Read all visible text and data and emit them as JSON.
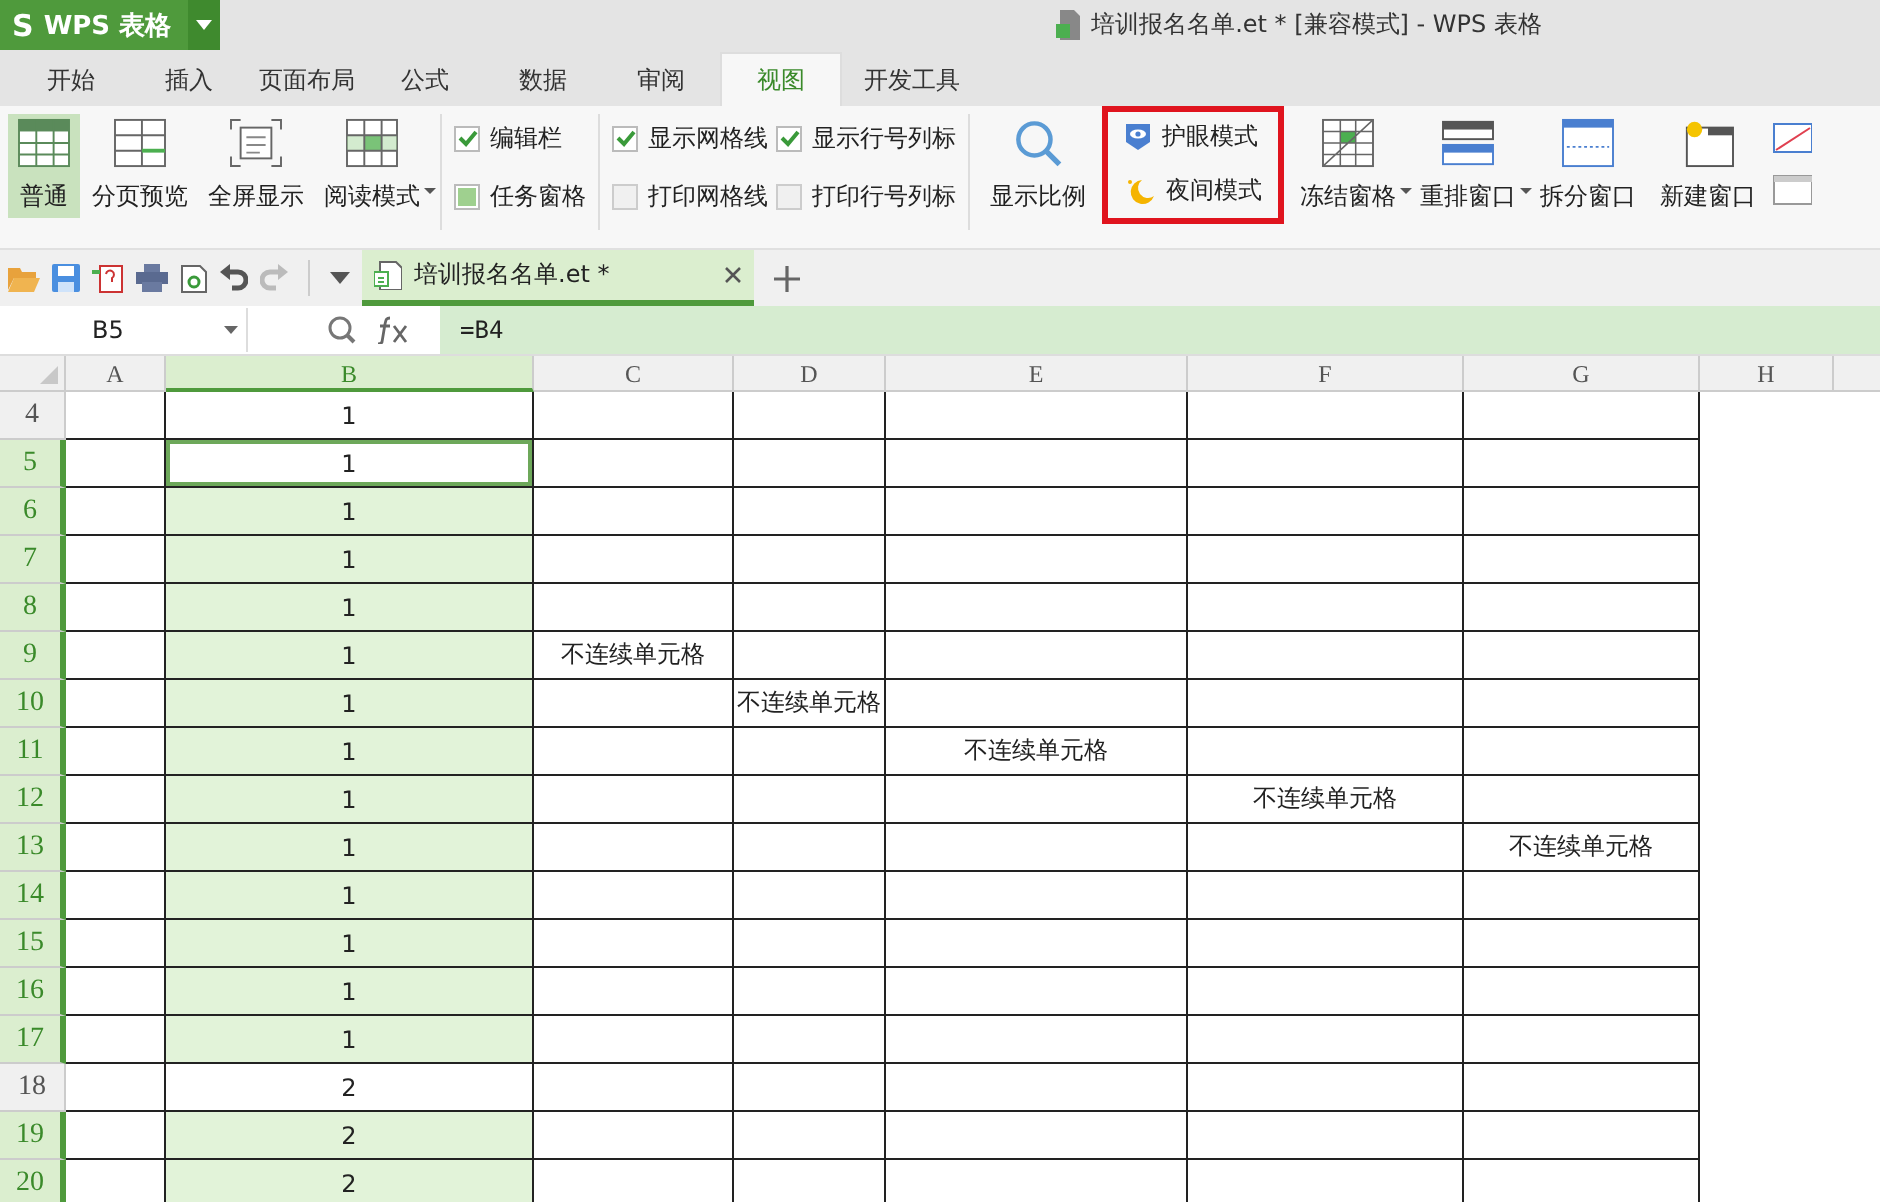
{
  "app": {
    "logo": "S",
    "name": "WPS 表格"
  },
  "window": {
    "title": "培训报名名单.et * [兼容模式] - WPS 表格"
  },
  "tabs": [
    {
      "label": "开始",
      "selected": false
    },
    {
      "label": "插入",
      "selected": false
    },
    {
      "label": "页面布局",
      "selected": false
    },
    {
      "label": "公式",
      "selected": false
    },
    {
      "label": "数据",
      "selected": false
    },
    {
      "label": "审阅",
      "selected": false
    },
    {
      "label": "视图",
      "selected": true
    },
    {
      "label": "开发工具",
      "selected": false
    }
  ],
  "ribbon": {
    "view_buttons": [
      {
        "kind": "normal",
        "label": "普通",
        "selected": true,
        "dropdown": false
      },
      {
        "kind": "page_break",
        "label": "分页预览",
        "selected": false,
        "dropdown": false
      },
      {
        "kind": "fullscreen",
        "label": "全屏显示",
        "selected": false,
        "dropdown": false
      },
      {
        "kind": "reading",
        "label": "阅读模式",
        "selected": false,
        "dropdown": true
      }
    ],
    "checkbox_columns": [
      [
        {
          "label": "编辑栏",
          "checked": true,
          "kind": "tick"
        },
        {
          "label": "任务窗格",
          "checked": true,
          "kind": "square"
        }
      ],
      [
        {
          "label": "显示网格线",
          "checked": true,
          "kind": "tick"
        },
        {
          "label": "打印网格线",
          "checked": false,
          "kind": "tick"
        }
      ],
      [
        {
          "label": "显示行号列标",
          "checked": true,
          "kind": "tick"
        },
        {
          "label": "打印行号列标",
          "checked": false,
          "kind": "tick"
        }
      ]
    ],
    "zoom_button": {
      "label": "显示比例"
    },
    "modes": {
      "highlighted": true,
      "items": [
        {
          "kind": "eye",
          "label": "护眼模式"
        },
        {
          "kind": "night",
          "label": "夜间模式"
        }
      ]
    },
    "window_buttons": [
      {
        "kind": "freeze",
        "label": "冻结窗格",
        "dropdown": true
      },
      {
        "kind": "arrange",
        "label": "重排窗口",
        "dropdown": true
      },
      {
        "kind": "split",
        "label": "拆分窗口",
        "dropdown": false
      },
      {
        "kind": "new",
        "label": "新建窗口",
        "dropdown": false
      }
    ]
  },
  "document_tab": {
    "label": "培训报名名单.et *",
    "selected": true
  },
  "formula_bar": {
    "cell": "B5",
    "formula": "=B4"
  },
  "sheet": {
    "columns": [
      {
        "label": "A",
        "selected": false
      },
      {
        "label": "B",
        "selected": true
      },
      {
        "label": "C",
        "selected": false
      },
      {
        "label": "D",
        "selected": false
      },
      {
        "label": "E",
        "selected": false
      },
      {
        "label": "F",
        "selected": false
      },
      {
        "label": "G",
        "selected": false
      },
      {
        "label": "H",
        "selected": false
      }
    ],
    "rows": [
      {
        "row": "4",
        "selected": false,
        "active": false,
        "b": "1"
      },
      {
        "row": "5",
        "selected": true,
        "active": true,
        "b": "1"
      },
      {
        "row": "6",
        "selected": true,
        "active": false,
        "b": "1"
      },
      {
        "row": "7",
        "selected": true,
        "active": false,
        "b": "1"
      },
      {
        "row": "8",
        "selected": true,
        "active": false,
        "b": "1"
      },
      {
        "row": "9",
        "selected": true,
        "active": false,
        "b": "1",
        "c": "不连续单元格"
      },
      {
        "row": "10",
        "selected": true,
        "active": false,
        "b": "1",
        "d": "不连续单元格"
      },
      {
        "row": "11",
        "selected": true,
        "active": false,
        "b": "1",
        "e": "不连续单元格"
      },
      {
        "row": "12",
        "selected": true,
        "active": false,
        "b": "1",
        "f": "不连续单元格"
      },
      {
        "row": "13",
        "selected": true,
        "active": false,
        "b": "1",
        "g": "不连续单元格"
      },
      {
        "row": "14",
        "selected": true,
        "active": false,
        "b": "1"
      },
      {
        "row": "15",
        "selected": true,
        "active": false,
        "b": "1"
      },
      {
        "row": "16",
        "selected": true,
        "active": false,
        "b": "1"
      },
      {
        "row": "17",
        "selected": true,
        "active": false,
        "b": "1"
      },
      {
        "row": "18",
        "selected": false,
        "active": false,
        "b": "2"
      },
      {
        "row": "19",
        "selected": true,
        "active": false,
        "b": "2"
      },
      {
        "row": "20",
        "selected": true,
        "active": false,
        "b": "2"
      }
    ]
  }
}
